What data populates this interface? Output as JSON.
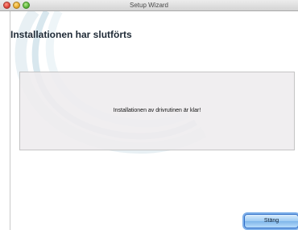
{
  "window": {
    "title": "Setup Wizard"
  },
  "page": {
    "heading": "Installationen har slutförts",
    "message": "Installationen av drivrutinen är klar!"
  },
  "buttons": {
    "close_label": "Stäng"
  },
  "colors": {
    "accent": "#2f6cc6",
    "panel_background": "#eeeceee0",
    "heading_text": "#1f2a36"
  },
  "icons": {
    "window_controls": [
      "close-icon",
      "minimize-icon",
      "zoom-icon"
    ]
  }
}
